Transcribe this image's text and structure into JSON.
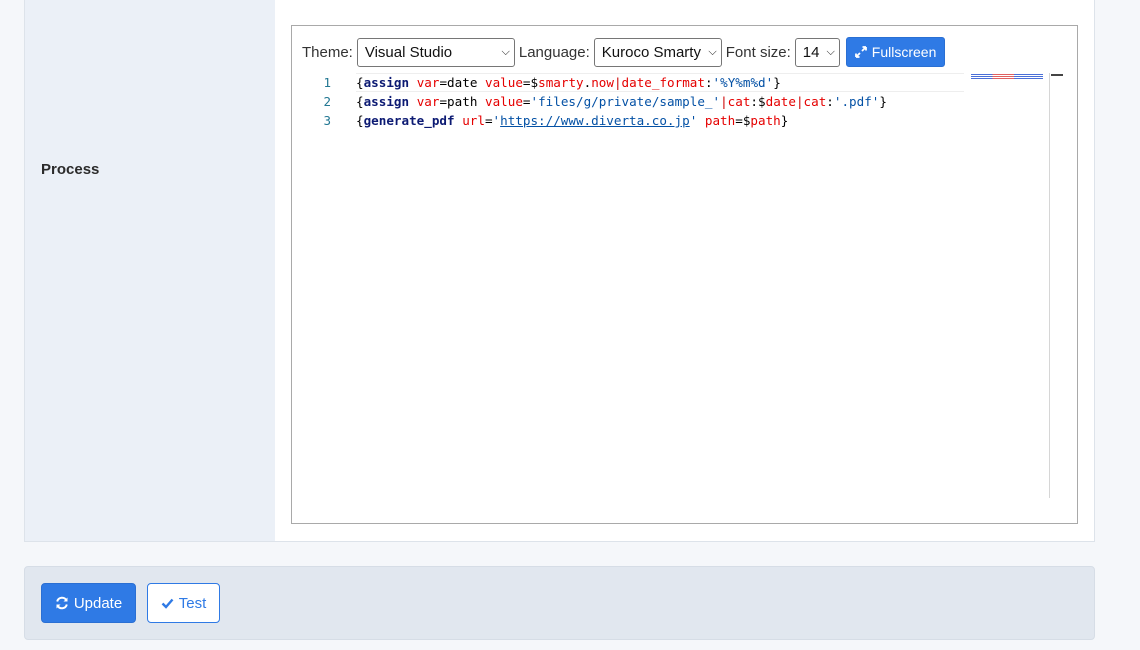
{
  "row": {
    "label": "Process"
  },
  "toolbar": {
    "theme_label": "Theme:",
    "theme_value": "Visual Studio",
    "language_label": "Language:",
    "language_value": "Kuroco Smarty",
    "font_size_label": "Font size:",
    "font_size_value": "14",
    "fullscreen_label": "Fullscreen"
  },
  "editor": {
    "line_numbers": [
      "1",
      "2",
      "3"
    ],
    "lines": [
      "{assign var=date value=$smarty.now|date_format:'%Y%m%d'}",
      "{assign var=path value='files/g/private/sample_'|cat:$date|cat:'.pdf'}",
      "{generate_pdf url='https://www.diverta.co.jp' path=$path}"
    ]
  },
  "footer": {
    "update_label": "Update",
    "test_label": "Test"
  },
  "colors": {
    "accent": "#2f7ae5",
    "label_bg": "#ebf0f7"
  },
  "icons": [
    "expand-icon",
    "refresh-icon",
    "check-icon"
  ]
}
